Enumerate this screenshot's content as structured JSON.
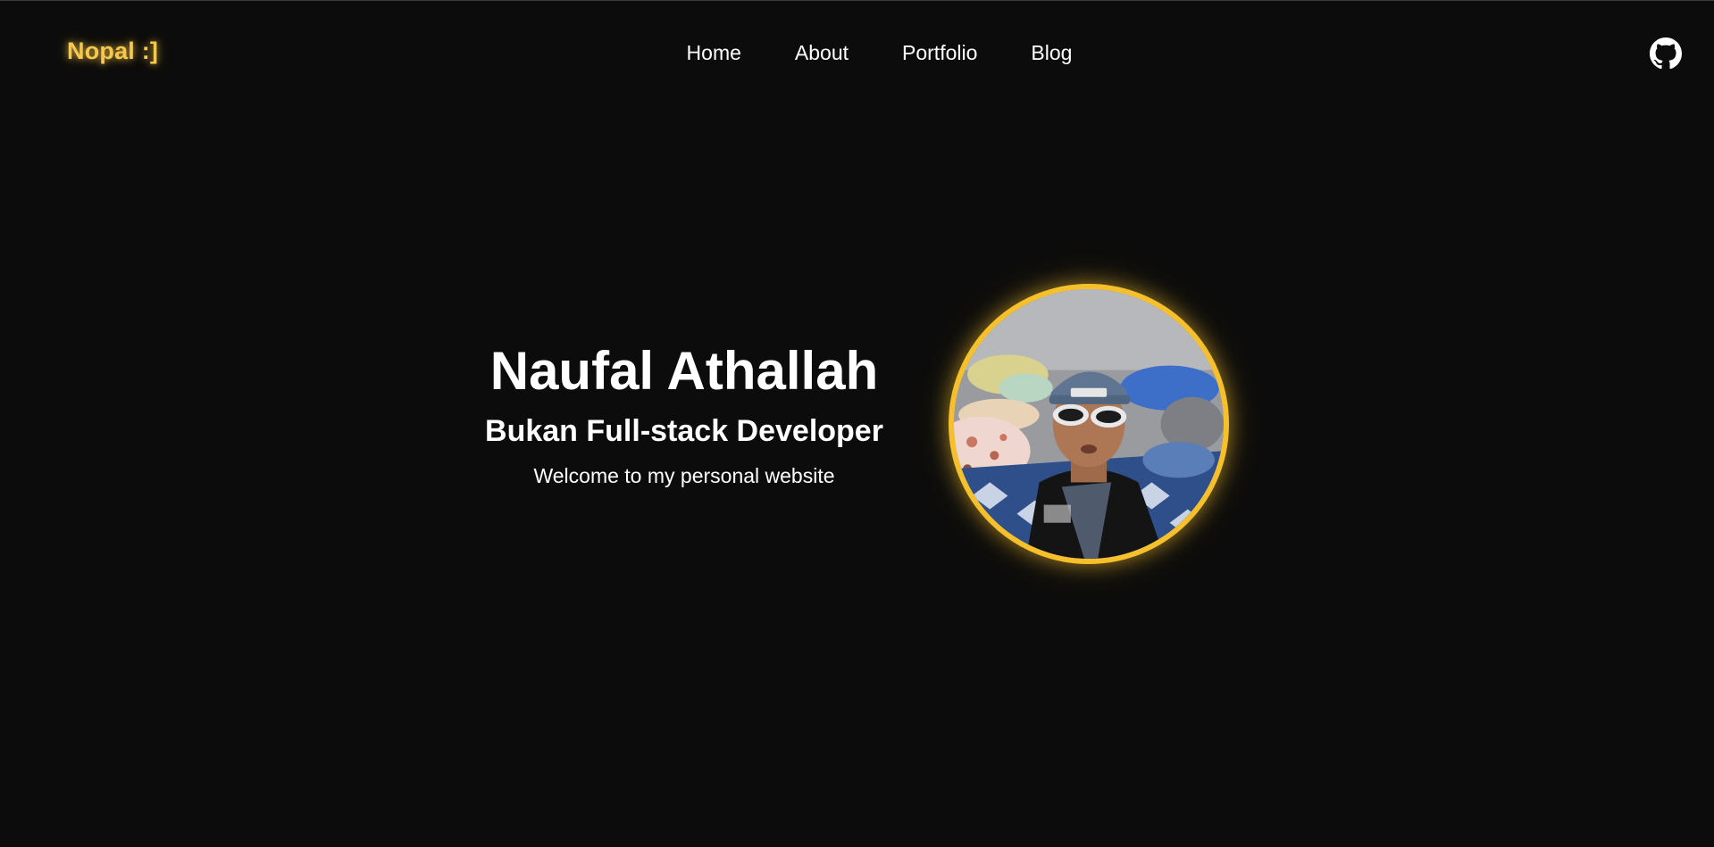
{
  "header": {
    "logo": "Nopal :]",
    "nav": [
      {
        "label": "Home"
      },
      {
        "label": "About"
      },
      {
        "label": "Portfolio"
      },
      {
        "label": "Blog"
      }
    ],
    "github_icon": "github-icon"
  },
  "hero": {
    "name": "Naufal Athallah",
    "role": "Bukan Full-stack Developer",
    "welcome": "Welcome to my personal website"
  },
  "colors": {
    "background": "#0c0c0c",
    "accent": "#f5c02c",
    "logo": "#f5c84c",
    "text": "#ffffff"
  }
}
